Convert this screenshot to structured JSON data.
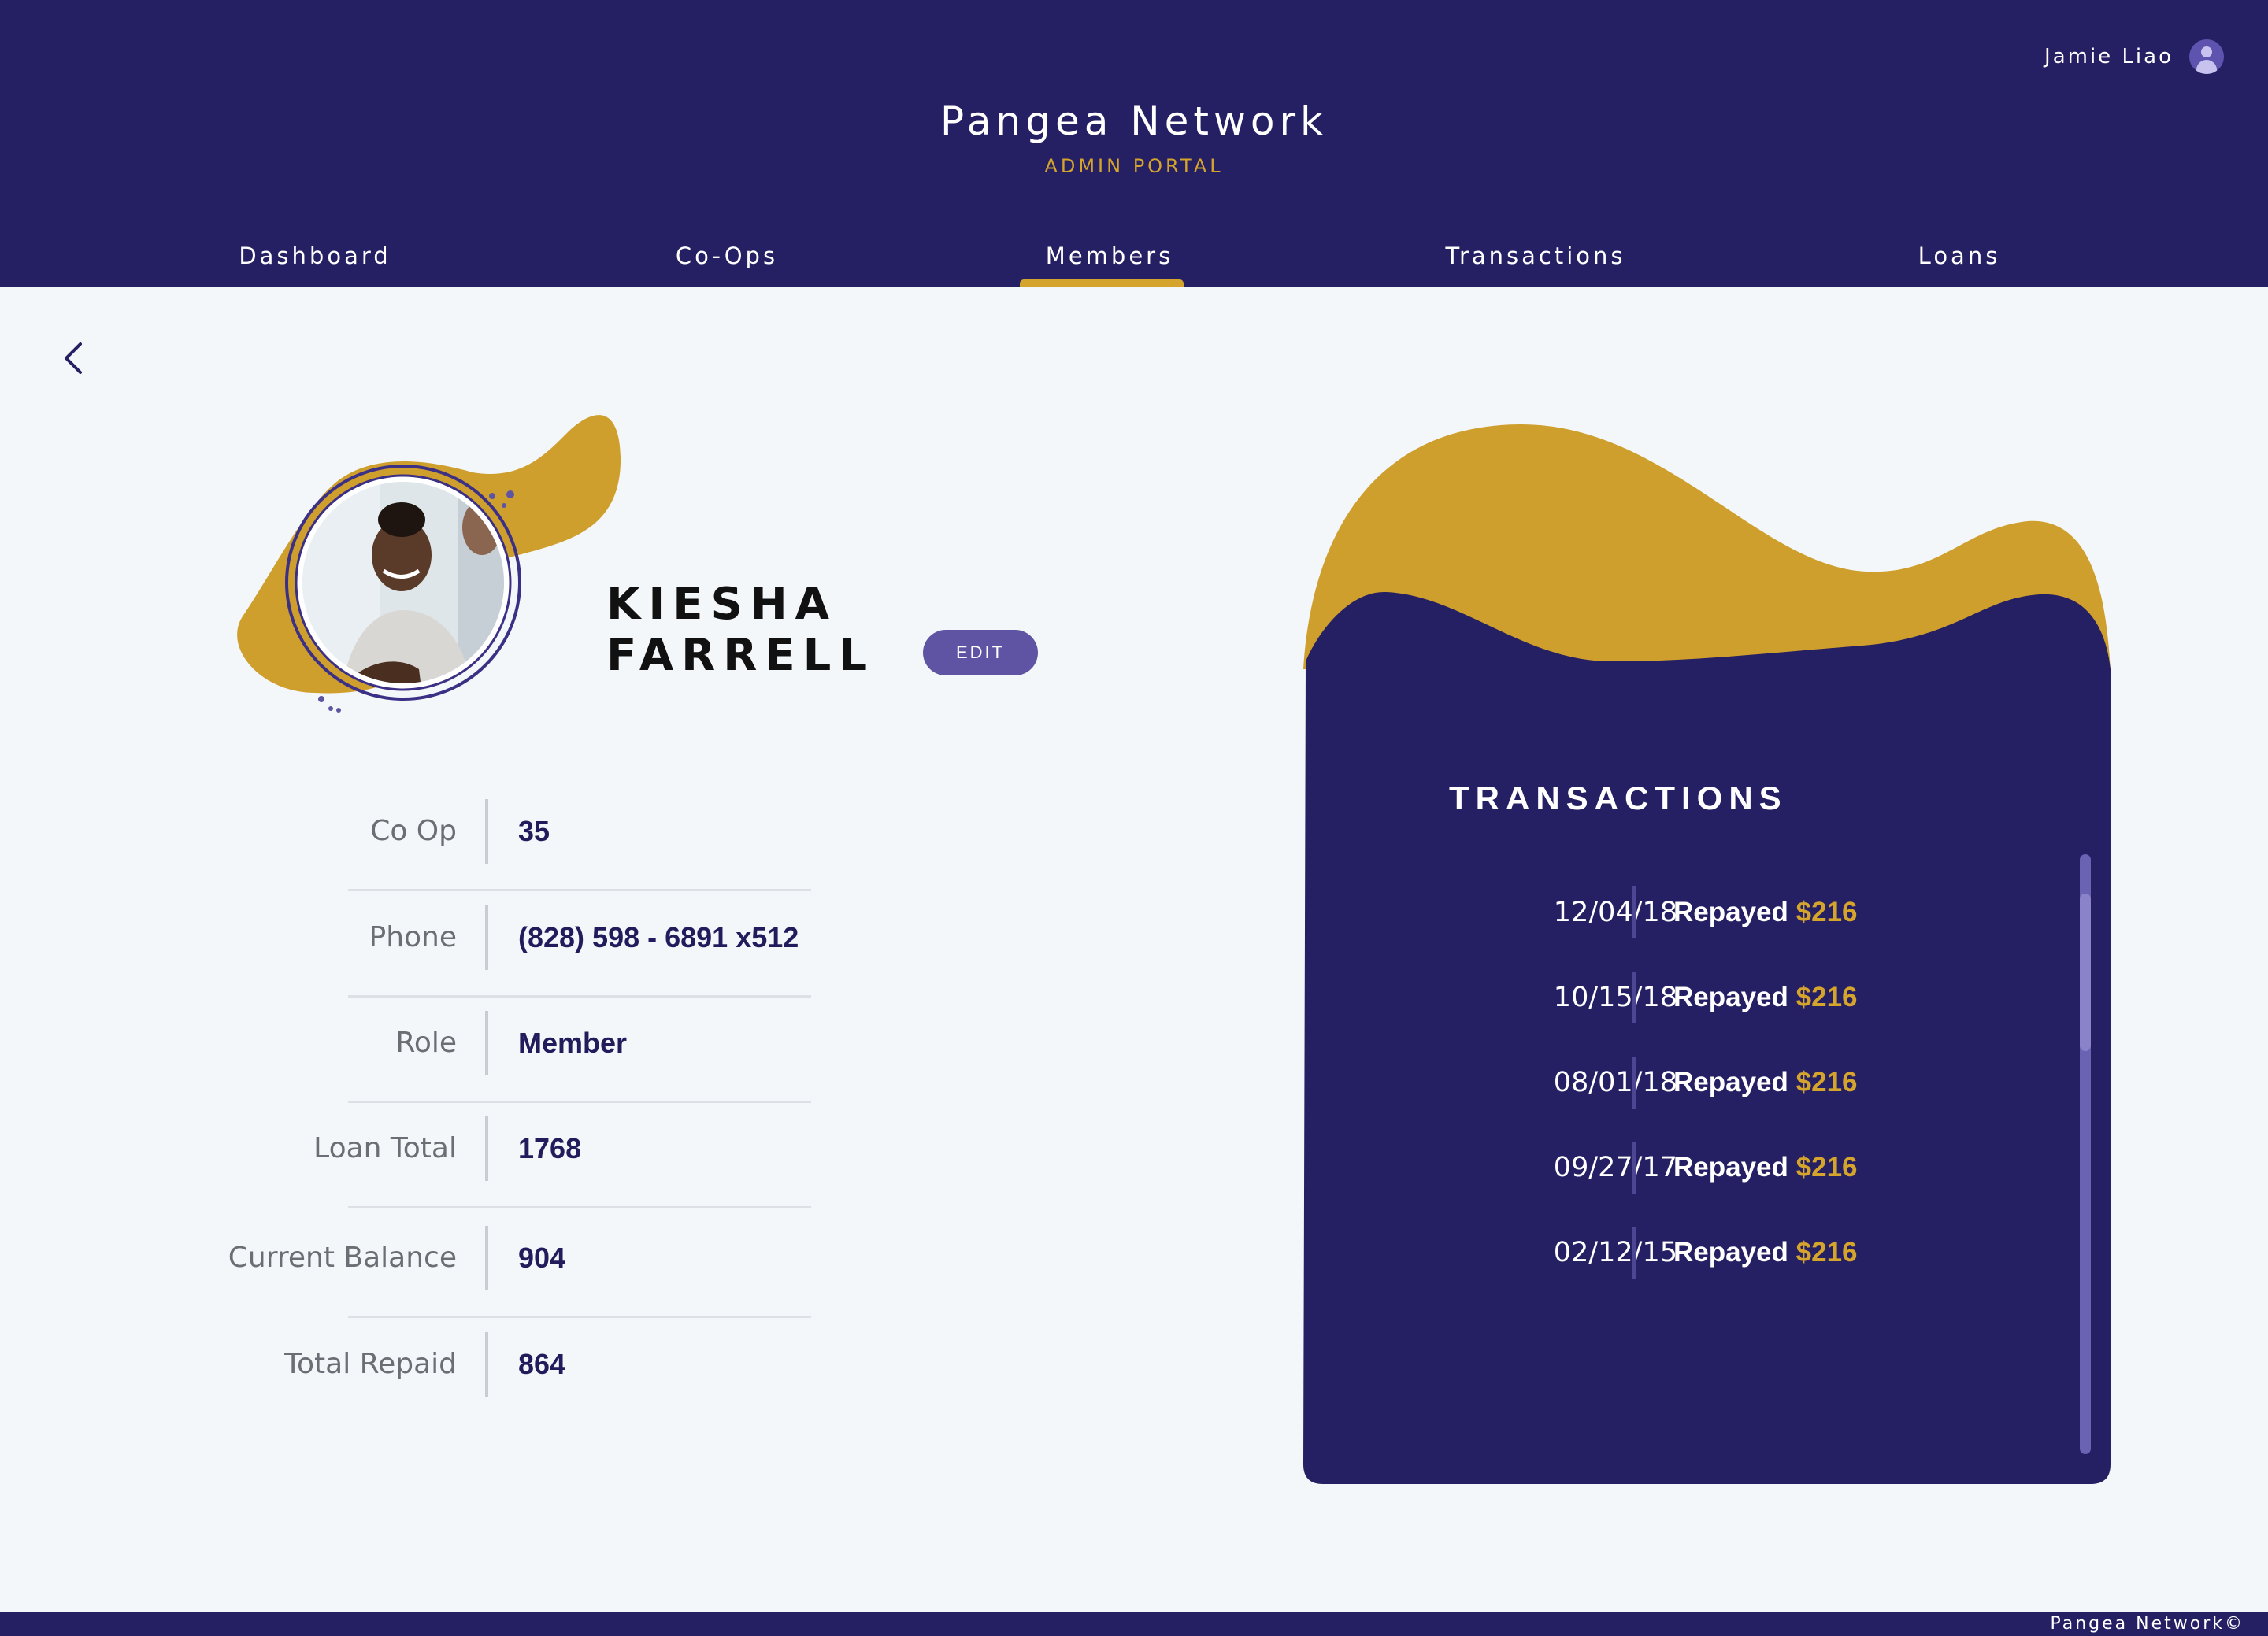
{
  "header": {
    "user_name": "Jamie Liao",
    "brand": "Pangea Network",
    "subtitle": "ADMIN PORTAL"
  },
  "nav": {
    "tabs": [
      {
        "label": "Dashboard"
      },
      {
        "label": "Co-Ops"
      },
      {
        "label": "Members",
        "active": true
      },
      {
        "label": "Transactions"
      },
      {
        "label": "Loans"
      }
    ]
  },
  "profile": {
    "first_name": "KIESHA",
    "last_name": "FARRELL",
    "edit_label": "EDIT"
  },
  "details": [
    {
      "label": "Co Op",
      "value": "35"
    },
    {
      "label": "Phone",
      "value": "(828) 598 - 6891 x512"
    },
    {
      "label": "Role",
      "value": "Member"
    },
    {
      "label": "Loan Total",
      "value": "1768"
    },
    {
      "label": "Current Balance",
      "value": "904"
    },
    {
      "label": "Total Repaid",
      "value": "864"
    }
  ],
  "transactions": {
    "title": "TRANSACTIONS",
    "rows": [
      {
        "date": "12/04/18",
        "action": "Repayed",
        "amount": "$216"
      },
      {
        "date": "10/15/18",
        "action": "Repayed",
        "amount": "$216"
      },
      {
        "date": "08/01/18",
        "action": "Repayed",
        "amount": "$216"
      },
      {
        "date": "09/27/17",
        "action": "Repayed",
        "amount": "$216"
      },
      {
        "date": "02/12/15",
        "action": "Repayed",
        "amount": "$216"
      }
    ]
  },
  "footer": {
    "text": "Pangea Network©"
  },
  "colors": {
    "navy": "#251f63",
    "gold": "#d5a42d",
    "button": "#5e54a3",
    "background": "#f4f7f9"
  },
  "icons": [
    "user-avatar-icon",
    "chevron-left-icon"
  ]
}
